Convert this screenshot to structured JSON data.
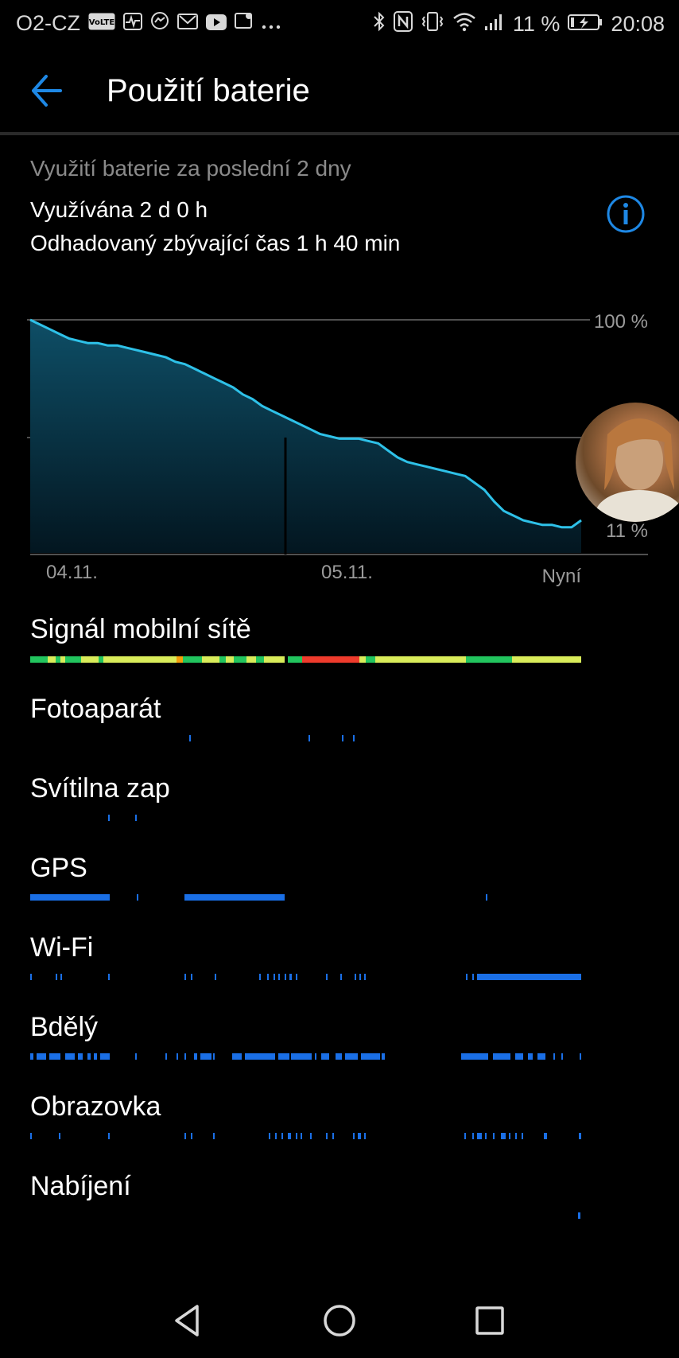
{
  "status": {
    "carrier": "O2-CZ",
    "battery_pct": "11 %",
    "time": "20:08",
    "left_icons": [
      "volte-icon",
      "pulse-icon",
      "messenger-icon",
      "mail-icon",
      "youtube-icon",
      "photo-location-icon",
      "more-dots-icon"
    ],
    "right_icons": [
      "bluetooth-icon",
      "nfc-icon",
      "vibrate-icon",
      "wifi-icon",
      "signal-icon",
      "battery-charging-icon"
    ]
  },
  "header": {
    "title": "Použití baterie"
  },
  "summary": {
    "subtitle": "Využití baterie za poslední 2 dny",
    "used": "Využívána 2 d 0 h",
    "remaining": "Odhadovaný zbývající čas 1 h 40 min"
  },
  "chart_data": {
    "type": "area",
    "x_labels": [
      "04.11.",
      "05.11.",
      "Nyní"
    ],
    "y_labels": [
      "100 %",
      "11 %"
    ],
    "ylim": [
      0,
      100
    ],
    "series": [
      {
        "values": [
          100,
          98,
          96,
          94,
          92,
          91,
          90,
          90,
          89,
          89,
          88,
          87,
          86,
          85,
          84,
          82,
          81,
          79,
          77,
          75,
          73,
          71,
          68,
          66,
          63,
          61,
          59,
          57,
          55,
          53,
          51,
          50,
          49,
          49,
          49,
          48,
          47,
          44,
          41,
          39,
          38,
          37,
          36,
          35,
          34,
          33,
          30,
          27,
          22,
          18,
          16,
          14,
          13,
          12,
          12,
          11,
          11,
          14
        ]
      }
    ]
  },
  "rows": [
    {
      "label": "Signál mobilní sítě"
    },
    {
      "label": "Fotoaparát"
    },
    {
      "label": "Svítilna zap"
    },
    {
      "label": "GPS"
    },
    {
      "label": "Wi-Fi"
    },
    {
      "label": "Bdělý"
    },
    {
      "label": "Obrazovka"
    },
    {
      "label": "Nabíjení"
    }
  ],
  "colors": {
    "accent": "#1e88e5",
    "line": "#2ec1e8",
    "activity": "#1a6fe6",
    "signal_green": "#22c55e",
    "signal_yellow": "#d9ec5a",
    "signal_red": "#ef3b2c",
    "signal_orange": "#f59e0b"
  }
}
